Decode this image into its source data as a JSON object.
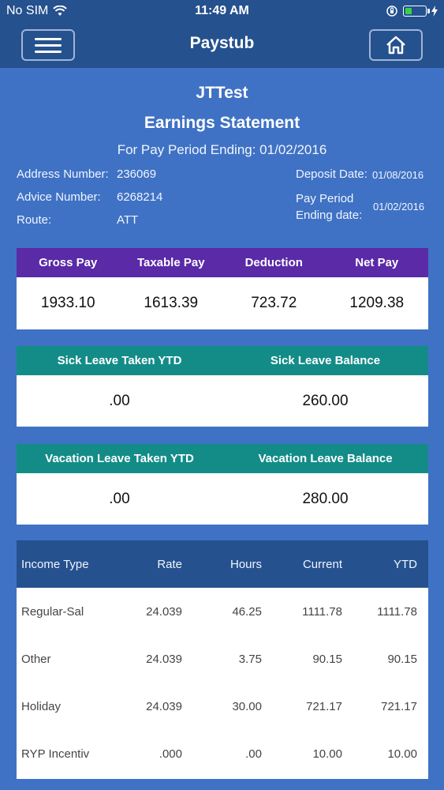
{
  "status": {
    "carrier": "No SIM",
    "time": "11:49 AM"
  },
  "nav": {
    "title": "Paystub"
  },
  "header": {
    "company": "JTTest",
    "statement_title": "Earnings Statement",
    "pay_period": "For Pay Period Ending: 01/02/2016"
  },
  "info_left": [
    {
      "label": "Address Number:",
      "value": "236069"
    },
    {
      "label": "Advice Number:",
      "value": "6268214"
    },
    {
      "label": "Route:",
      "value": "ATT"
    }
  ],
  "info_right": {
    "deposit_label": "Deposit Date:",
    "deposit_value": "01/08/2016",
    "ending_label_1": "Pay Period",
    "ending_label_2": "Ending date:",
    "ending_value": "01/02/2016"
  },
  "pay_summary": {
    "headers": [
      "Gross Pay",
      "Taxable Pay",
      "Deduction",
      "Net Pay"
    ],
    "values": [
      "1933.10",
      "1613.39",
      "723.72",
      "1209.38"
    ]
  },
  "sick_leave": {
    "headers": [
      "Sick Leave Taken YTD",
      "Sick Leave Balance"
    ],
    "values": [
      ".00",
      "260.00"
    ]
  },
  "vacation_leave": {
    "headers": [
      "Vacation Leave Taken YTD",
      "Vacation Leave Balance"
    ],
    "values": [
      ".00",
      "280.00"
    ]
  },
  "income": {
    "headers": [
      "Income Type",
      "Rate",
      "Hours",
      "Current",
      "YTD"
    ],
    "rows": [
      [
        "Regular-Sal",
        "24.039",
        "46.25",
        "1111.78",
        "1111.78"
      ],
      [
        "Other",
        "24.039",
        "3.75",
        "90.15",
        "90.15"
      ],
      [
        "Holiday",
        "24.039",
        "30.00",
        "721.17",
        "721.17"
      ],
      [
        "RYP Incentiv",
        ".000",
        ".00",
        "10.00",
        "10.00"
      ]
    ]
  },
  "colors": {
    "background": "#3f72c4",
    "navbar": "#25518e",
    "purple_header": "#5a2aa7",
    "teal_header": "#138c88"
  }
}
